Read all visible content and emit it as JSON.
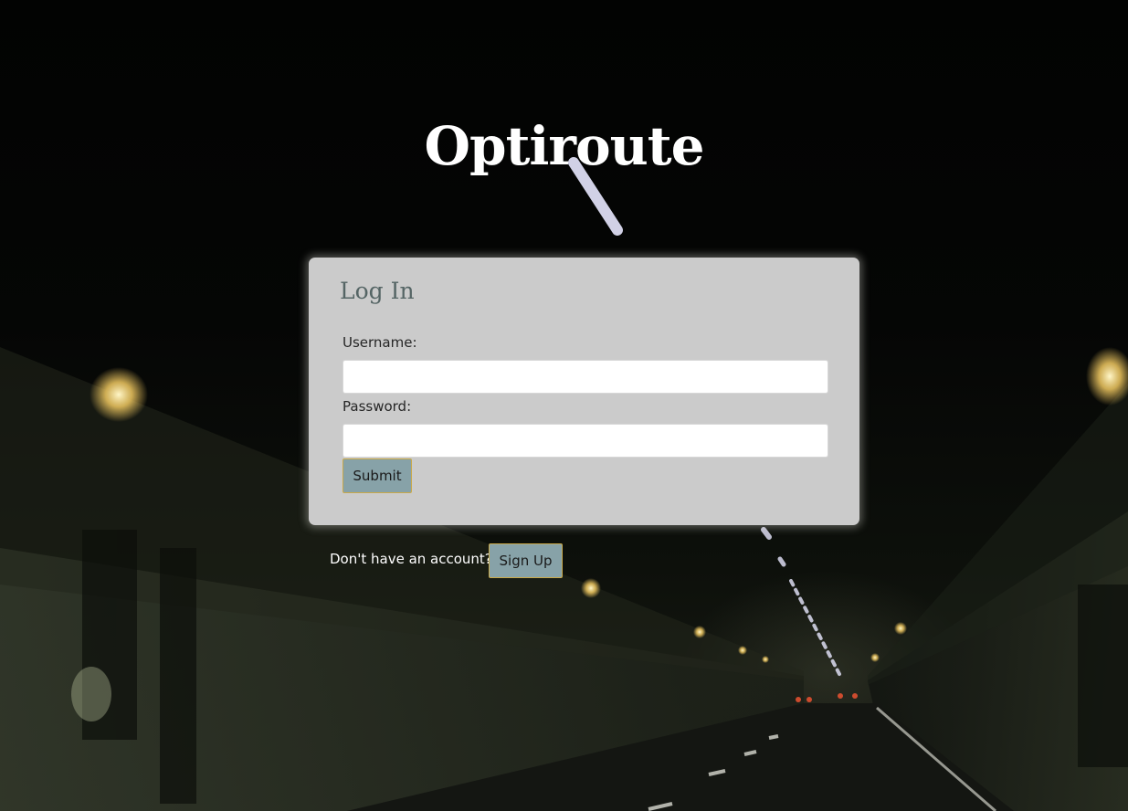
{
  "app": {
    "title": "Optiroute"
  },
  "login": {
    "heading": "Log In",
    "username_label": "Username:",
    "username_value": "",
    "password_label": "Password:",
    "password_value": "",
    "submit_label": "Submit"
  },
  "signup": {
    "prompt": "Don't have an account?",
    "button_label": "Sign Up"
  },
  "colors": {
    "card_background": "#cbcbcb",
    "heading_text": "#556565",
    "button_fill": "#87a2a8",
    "button_border": "#c9a94a"
  }
}
